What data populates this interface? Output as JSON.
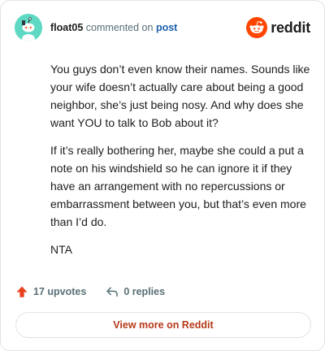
{
  "header": {
    "username": "float05",
    "commented_on_text": "commented on",
    "post_link": "post",
    "brand_name": "reddit"
  },
  "comment": {
    "paragraphs": [
      "You guys don’t even know their names. Sounds like your wife doesn’t actually care about being a good neighbor, she’s just being nosy. And why does she want YOU to talk to Bob about it?",
      "If it’s really bothering her, maybe she could a put a note on his windshield so he can ignore it if they have an arrangement with no repercussions or embarrassment between you, but that’s even more than I’d do.",
      "NTA"
    ]
  },
  "actions": {
    "upvotes": "17 upvotes",
    "replies": "0 replies"
  },
  "footer": {
    "view_more_label": "View more on Reddit"
  },
  "colors": {
    "avatar_bg": "#5fd8c4",
    "brand_orange": "#ff4500",
    "link_blue": "#1c5faa",
    "button_text": "#b5391a",
    "upvote": "#e8401d"
  },
  "icons": {
    "avatar": "snoo-avatar-icon",
    "brand": "reddit-logo-icon",
    "upvote": "upvote-arrow-icon",
    "reply": "reply-arrow-icon"
  }
}
